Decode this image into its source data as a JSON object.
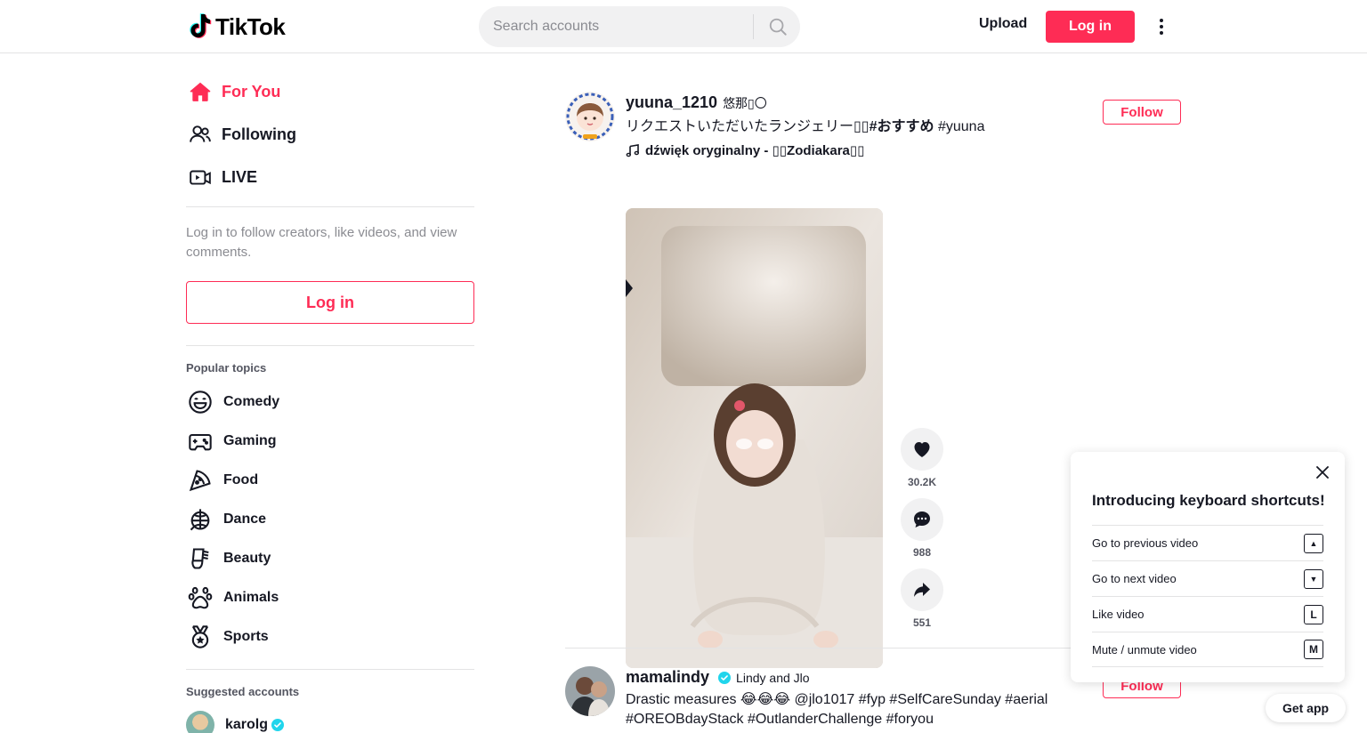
{
  "header": {
    "logo_text": "TikTok",
    "search_placeholder": "Search accounts",
    "upload_label": "Upload",
    "login_label": "Log in"
  },
  "sidebar": {
    "nav": [
      {
        "label": "For You",
        "icon": "home-icon",
        "active": true
      },
      {
        "label": "Following",
        "icon": "users-icon",
        "active": false
      },
      {
        "label": "LIVE",
        "icon": "live-icon",
        "active": false
      }
    ],
    "login_hint": "Log in to follow creators, like videos, and view comments.",
    "login_label": "Log in",
    "popular_topics_title": "Popular topics",
    "topics": [
      {
        "label": "Comedy",
        "icon": "comedy-icon"
      },
      {
        "label": "Gaming",
        "icon": "gaming-icon"
      },
      {
        "label": "Food",
        "icon": "food-icon"
      },
      {
        "label": "Dance",
        "icon": "dance-icon"
      },
      {
        "label": "Beauty",
        "icon": "beauty-icon"
      },
      {
        "label": "Animals",
        "icon": "animals-icon"
      },
      {
        "label": "Sports",
        "icon": "sports-icon"
      }
    ],
    "suggested_title": "Suggested accounts",
    "suggested": [
      {
        "name": "karolg",
        "verified": true
      }
    ]
  },
  "feed": {
    "posts": [
      {
        "author": "yuuna_1210",
        "nickname": "悠那▯〇",
        "caption_text": "リクエストいただいたランジェリー▯▯",
        "caption_tags": "#おすすめ",
        "caption_tags_2": "#yuuna",
        "music": "dźwięk oryginalny - ▯▯Zodiakara▯▯",
        "follow_label": "Follow",
        "likes": "30.2K",
        "comments": "988",
        "shares": "551"
      },
      {
        "author": "mamalindy",
        "verified": true,
        "nickname": "Lindy and Jlo",
        "caption_line1_text": "Drastic measures 😂😂😂 ",
        "caption_line1_tags": "@jlo1017 #fyp #SelfCareSunday #aerial",
        "caption_line2_tags": "#OREOBdayStack #OutlanderChallenge #foryou",
        "follow_label": "Follow"
      }
    ]
  },
  "shortcuts_popup": {
    "title": "Introducing keyboard shortcuts!",
    "items": [
      {
        "label": "Go to previous video",
        "key": "▲"
      },
      {
        "label": "Go to next video",
        "key": "▼"
      },
      {
        "label": "Like video",
        "key": "L"
      },
      {
        "label": "Mute / unmute video",
        "key": "M"
      }
    ]
  },
  "get_app_label": "Get app",
  "colors": {
    "brand": "#fe2c55",
    "text": "#161823",
    "muted": "#8a8b91",
    "verified": "#20d5ec"
  }
}
